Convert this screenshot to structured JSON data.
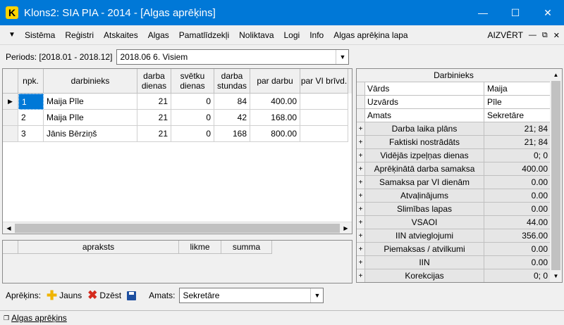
{
  "window": {
    "app_icon_letter": "K",
    "title": "Klons2: SIA PIA - 2014 - [Algas aprēķins]",
    "minimize_icon": "minimize-icon",
    "maximize_icon": "maximize-icon",
    "close_icon": "close-icon"
  },
  "menu": {
    "items": [
      "Sistēma",
      "Reģistri",
      "Atskaites",
      "Algas",
      "Pamatlīdzekļi",
      "Noliktava",
      "Logi",
      "Info",
      "Algas aprēķina lapa"
    ],
    "close_label": "AIZVĒRT"
  },
  "periods": {
    "label": "Periods: [2018.01 - 2018.12]",
    "selected": "2018.06 6. Visiem"
  },
  "main_grid": {
    "columns": [
      "npk.",
      "darbinieks",
      "darba dienas",
      "svētku dienas",
      "darba stundas",
      "par darbu",
      "par VI brīvd."
    ],
    "rows": [
      {
        "npk": "1",
        "darbinieks": "Maija Pīle",
        "darba_dienas": "21",
        "svetku_dienas": "0",
        "darba_stundas": "84",
        "par_darbu": "400.00",
        "par_vi": ""
      },
      {
        "npk": "2",
        "darbinieks": "Maija Pīle",
        "darba_dienas": "21",
        "svetku_dienas": "0",
        "darba_stundas": "42",
        "par_darbu": "168.00",
        "par_vi": ""
      },
      {
        "npk": "3",
        "darbinieks": "Jānis Bērziņš",
        "darba_dienas": "21",
        "svetku_dienas": "0",
        "darba_stundas": "168",
        "par_darbu": "800.00",
        "par_vi": ""
      }
    ]
  },
  "lower_grid": {
    "columns": [
      "apraksts",
      "likme",
      "summa"
    ]
  },
  "details": {
    "title": "Darbinieks",
    "fields": [
      {
        "label": "Vārds",
        "value": "Maija"
      },
      {
        "label": "Uzvārds",
        "value": "Pīle"
      },
      {
        "label": "Amats",
        "value": "Sekretāre"
      }
    ],
    "groups": [
      {
        "label": "Darba laika plāns",
        "value": "21; 84"
      },
      {
        "label": "Faktiski nostrādāts",
        "value": "21; 84"
      },
      {
        "label": "Vidējās izpeļņas dienas",
        "value": "0; 0"
      },
      {
        "label": "Aprēķinātā darba samaksa",
        "value": "400.00"
      },
      {
        "label": "Samaksa par VI dienām",
        "value": "0.00"
      },
      {
        "label": "Atvaļinājums",
        "value": "0.00"
      },
      {
        "label": "Slimības lapas",
        "value": "0.00"
      },
      {
        "label": "VSAOI",
        "value": "44.00"
      },
      {
        "label": "IIN atvieglojumi",
        "value": "356.00"
      },
      {
        "label": "Piemaksas / atvilkumi",
        "value": "0.00"
      },
      {
        "label": "IIN",
        "value": "0.00"
      },
      {
        "label": "Korekcijas",
        "value": "0; 0"
      }
    ]
  },
  "bottom": {
    "aprekins_label": "Aprēķins:",
    "new_label": "Jauns",
    "delete_label": "Dzēst",
    "amats_label": "Amats:",
    "amats_value": "Sekretāre"
  },
  "status": {
    "tab_label": "Algas aprēķins"
  },
  "colors": {
    "titlebar": "#0078d7",
    "app_icon": "#ffd400",
    "selected_cell": "#0078d7",
    "new_icon": "#f0b400",
    "delete_icon": "#d52b1e",
    "save_icon": "#1d4fa0"
  }
}
